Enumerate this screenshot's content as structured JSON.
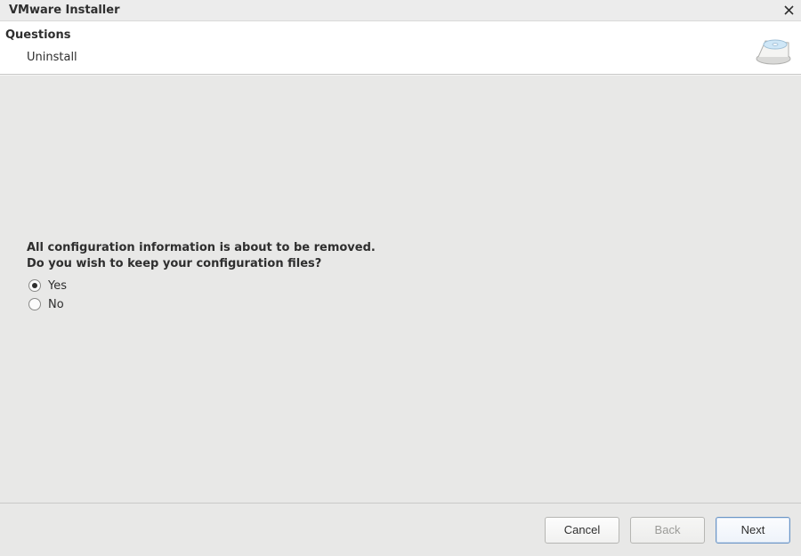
{
  "titlebar": {
    "title": "VMware Installer",
    "close_icon": "close-icon"
  },
  "header": {
    "section_label": "Questions",
    "subtitle": "Uninstall",
    "icon": "disk-icon"
  },
  "content": {
    "question_line1": "All configuration information is about to be removed.",
    "question_line2": "Do you wish to keep your configuration files?",
    "options": [
      {
        "label": "Yes",
        "checked": true
      },
      {
        "label": "No",
        "checked": false
      }
    ]
  },
  "footer": {
    "cancel_label": "Cancel",
    "back_label": "Back",
    "next_label": "Next",
    "back_disabled": true
  }
}
